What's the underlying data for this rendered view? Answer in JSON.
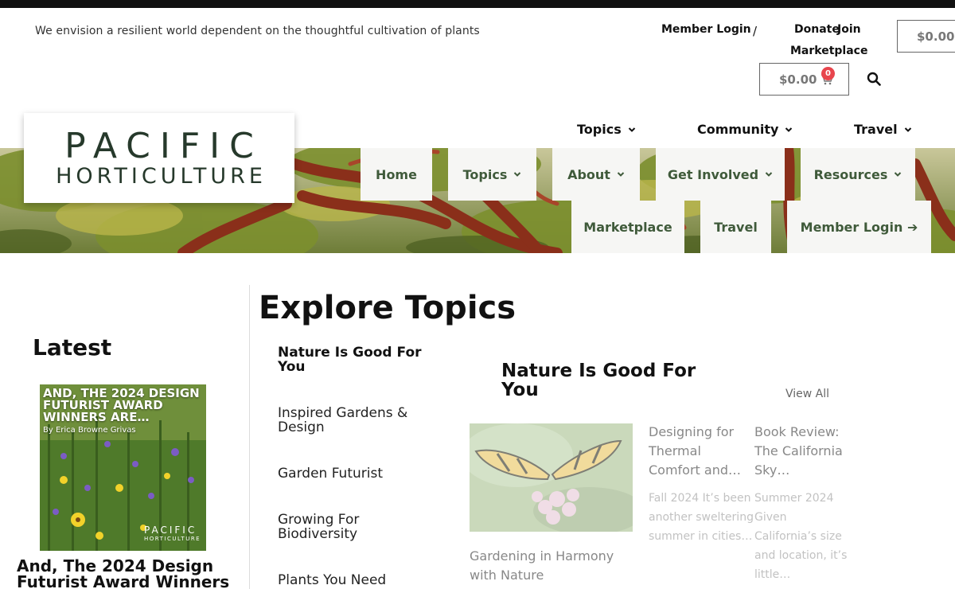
{
  "header": {
    "tagline": "We envision a resilient world dependent on the thoughtful cultivation of plants",
    "member_login": "Member Login",
    "separator": "/",
    "donate": "Donate",
    "join": "Join",
    "marketplace": "Marketplace",
    "cart_top": "$0.00",
    "cart_main": "$0.00",
    "cart_count": "0"
  },
  "secondary_nav": [
    "Topics",
    "Community",
    "Travel"
  ],
  "logo": {
    "line1": "PACIFIC",
    "line2": "HORTICULTURE"
  },
  "main_nav": {
    "row1": [
      "Home",
      "Topics",
      "About",
      "Get Involved",
      "Resources"
    ],
    "row2": [
      "Marketplace",
      "Travel",
      "Member Login ➔"
    ]
  },
  "latest": {
    "title": "Latest",
    "image_title": "AND, THE 2024 DESIGN FUTURIST AWARD WINNERS ARE…",
    "image_author": "By Erica Browne Grivas",
    "image_logo_1": "PACIFIC",
    "image_logo_2": "HORTICULTURE",
    "headline": "And, The 2024 Design Futurist Award Winners"
  },
  "explore": {
    "title": "Explore Topics",
    "topics": [
      "Nature Is Good For You",
      "Inspired Gardens & Design",
      "Garden Futurist",
      "Growing For Biodiversity",
      "Plants You Need"
    ],
    "section_title": "Nature Is Good For You",
    "view_all": "View All",
    "articles": [
      {
        "title": "Gardening in Harmony with Nature"
      },
      {
        "title": "Designing for Thermal Comfort and…",
        "excerpt": "Fall 2024 It’s been another sweltering summer in cities…"
      },
      {
        "title": "Book Review: The California Sky…",
        "excerpt": "Summer 2024 Given California’s size and location, it’s little…"
      }
    ]
  },
  "colors": {
    "nav_text": "#3f5a3a",
    "logo": "#26392b",
    "badge": "#e8454d"
  }
}
